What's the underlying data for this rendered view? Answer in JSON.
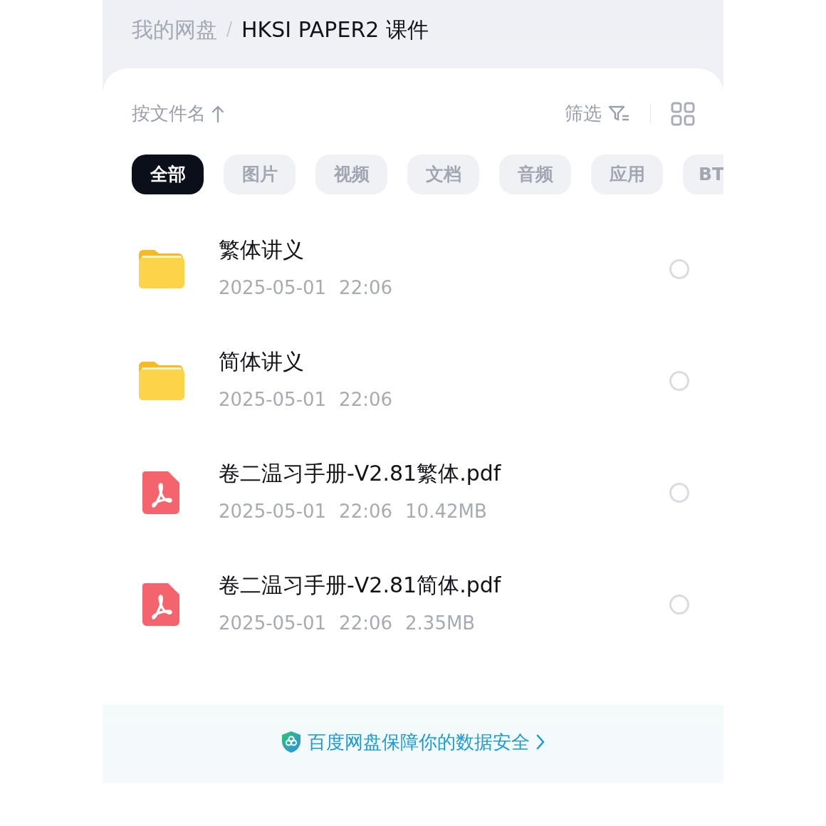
{
  "breadcrumb": [
    {
      "label": "我的网盘",
      "current": false
    },
    {
      "label": "HKSI PAPER2 课件",
      "current": true
    }
  ],
  "sort": {
    "label": "按文件名"
  },
  "filter": {
    "label": "筛选"
  },
  "categories": [
    {
      "label": "全部",
      "selected": true
    },
    {
      "label": "图片",
      "selected": false
    },
    {
      "label": "视频",
      "selected": false
    },
    {
      "label": "文档",
      "selected": false
    },
    {
      "label": "音频",
      "selected": false
    },
    {
      "label": "应用",
      "selected": false
    },
    {
      "label": "BT",
      "selected": false
    }
  ],
  "files": [
    {
      "kind": "folder",
      "name": "繁体讲义",
      "date": "2025-05-01",
      "time": "22:06",
      "selected": false
    },
    {
      "kind": "folder",
      "name": "简体讲义",
      "date": "2025-05-01",
      "time": "22:06",
      "selected": false
    },
    {
      "kind": "pdf",
      "name": "卷二温习手册-V2.81繁体.pdf",
      "date": "2025-05-01",
      "time": "22:06",
      "size": "10.42MB",
      "selected": false
    },
    {
      "kind": "pdf",
      "name": "卷二温习手册-V2.81简体.pdf",
      "date": "2025-05-01",
      "time": "22:06",
      "size": "2.35MB",
      "selected": false
    }
  ],
  "security_notice": {
    "label": "百度网盘保障你的数据安全"
  }
}
